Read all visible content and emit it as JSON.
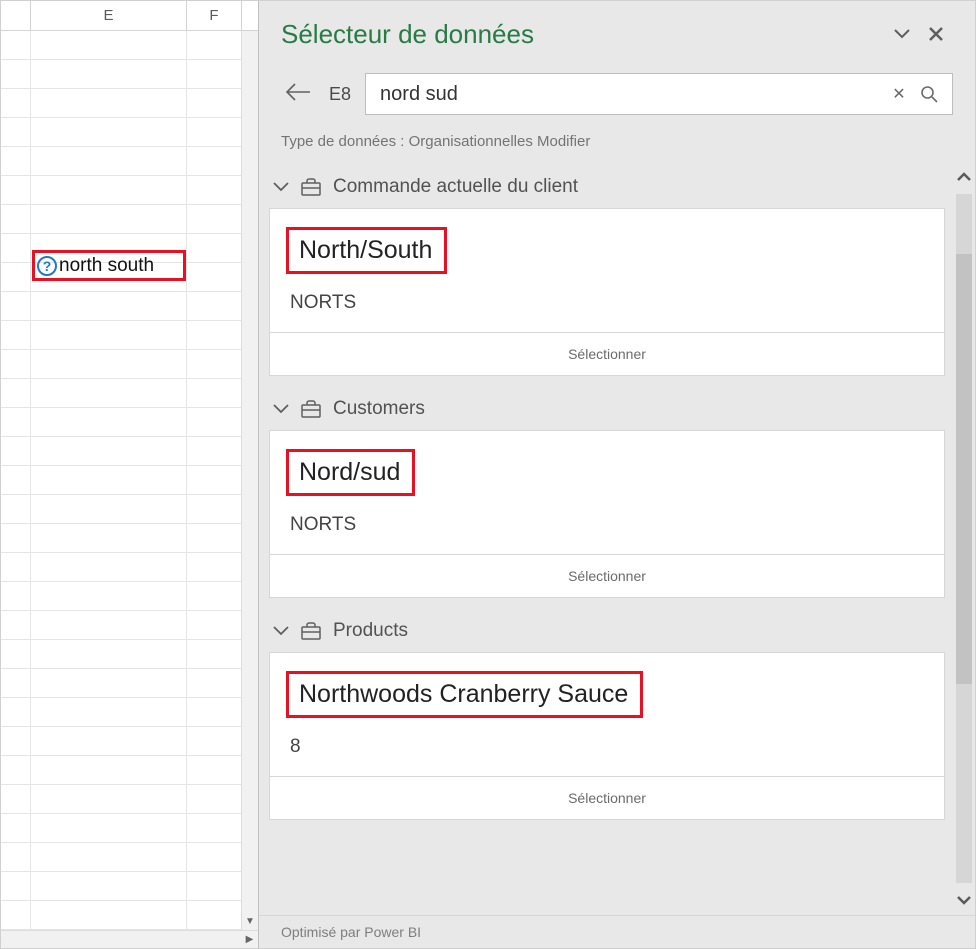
{
  "spreadsheet": {
    "columns": {
      "E": "E",
      "F": "F"
    },
    "highlighted_cell": {
      "value": "north south",
      "indicator": "?"
    }
  },
  "panel": {
    "title": "Sélecteur de données",
    "back": {
      "cell_ref": "E8"
    },
    "search": {
      "value": "nord sud",
      "clear_glyph": "✕"
    },
    "type_line": "Type de données : Organisationnelles Modifier",
    "groups": [
      {
        "title": "Commande actuelle du client",
        "result": {
          "title": "North/South",
          "sub": "NORTS",
          "select_label": "Sélectionner"
        }
      },
      {
        "title": "Customers",
        "result": {
          "title": "Nord/sud",
          "sub": "NORTS",
          "select_label": "Sélectionner"
        }
      },
      {
        "title": "Products",
        "result": {
          "title": "Northwoods Cranberry Sauce",
          "sub": "8",
          "select_label": "Sélectionner"
        }
      }
    ],
    "footer": "Optimisé par Power BI"
  }
}
